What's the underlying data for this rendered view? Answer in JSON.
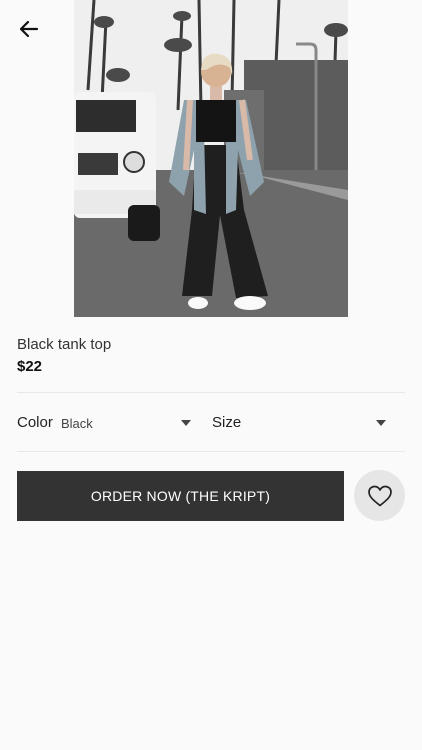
{
  "nav": {
    "back_icon": "arrow-left-icon"
  },
  "product": {
    "image_alt": "Product photo",
    "name": "Black tank top",
    "price": "$22"
  },
  "options": {
    "color_label": "Color",
    "color_value": "Black",
    "size_label": "Size",
    "size_value": ""
  },
  "actions": {
    "order_label": "ORDER NOW (THE KRIPT)",
    "favorite_icon": "heart-icon"
  },
  "colors": {
    "background": "#fafafa",
    "button": "#333333",
    "button_text": "#ffffff",
    "favorite_bg": "#e6e6e6"
  }
}
